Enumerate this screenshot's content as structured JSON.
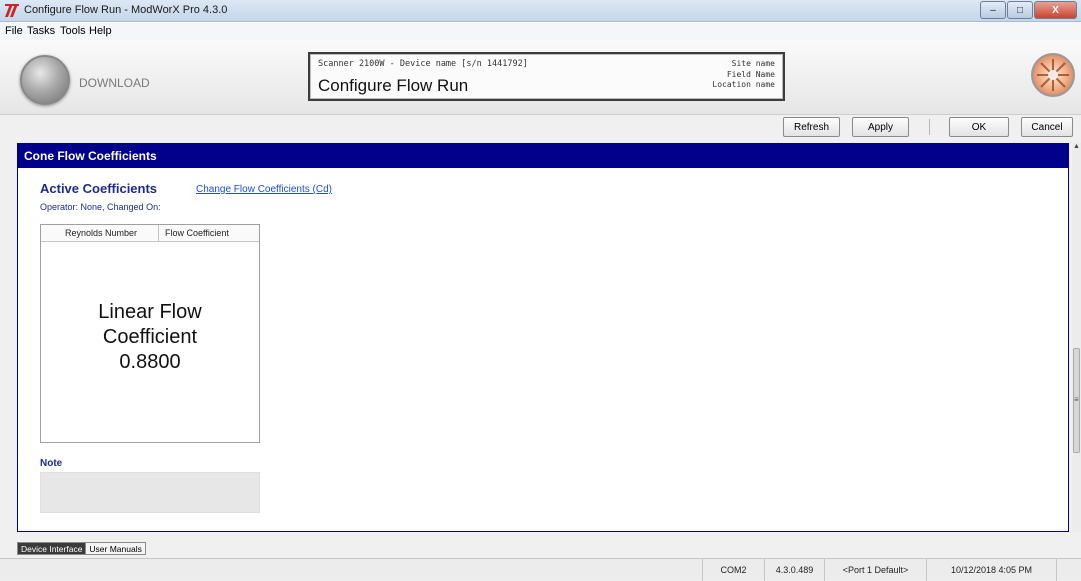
{
  "window": {
    "title": "Configure Flow Run - ModWorX Pro 4.3.0",
    "controls": {
      "minimize": "–",
      "maximize": "□",
      "close": "X"
    }
  },
  "menu": {
    "file": "File",
    "tasks": "Tasks",
    "tools": "Tools",
    "help": "Help"
  },
  "toolbar": {
    "download_label": "DOWNLOAD"
  },
  "header": {
    "scanner_line": "Scanner 2100W - Device name [s/n 1441792]",
    "title": "Configure Flow Run",
    "site_name": "Site name",
    "field_name": "Field Name",
    "location_name": "Location name"
  },
  "actions": {
    "refresh": "Refresh",
    "apply": "Apply",
    "ok": "OK",
    "cancel": "Cancel"
  },
  "panel": {
    "header": "Cone Flow Coefficients",
    "active_title": "Active Coefficients",
    "change_link": "Change Flow Coefficients (Cd)",
    "operator_line": "Operator: None, Changed On:",
    "table": {
      "columns": [
        "Reynolds Number",
        "Flow Coefficient"
      ],
      "line1": "Linear Flow",
      "line2": "Coefficient",
      "value": "0.8800"
    },
    "note_label": "Note",
    "note_text": ""
  },
  "bottom_tabs": [
    "Device Interface",
    "User Manuals"
  ],
  "status": {
    "port": "COM2",
    "version": "4.3.0.489",
    "profile": "<Port 1 Default>",
    "datetime": "10/12/2018 4:05 PM"
  },
  "colors": {
    "header_bar": "#00008b",
    "link": "#1a4fd1",
    "label_blue": "#1d2b8f"
  },
  "icons": {
    "app": "modworx-logo-icon",
    "download": "download-orb-icon",
    "brand": "scanner-brand-icon"
  }
}
